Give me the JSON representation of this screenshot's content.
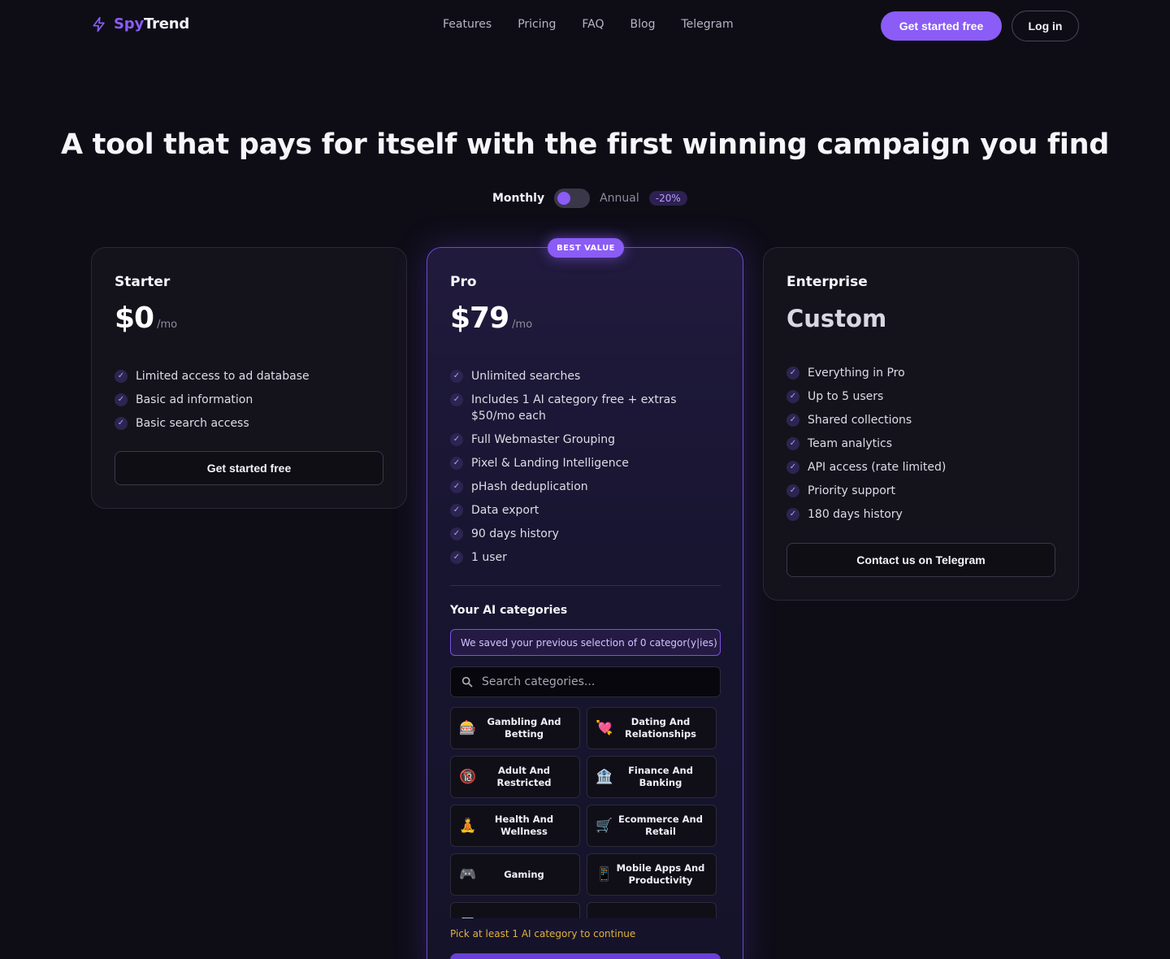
{
  "nav": {
    "logo_a": "Spy",
    "logo_b": "Trend",
    "links": [
      "Features",
      "Pricing",
      "FAQ",
      "Blog",
      "Telegram"
    ],
    "cta": "Get started free",
    "login": "Log in"
  },
  "hero": {
    "title": "A tool that pays for itself with the first winning campaign you find",
    "toggle_monthly": "Monthly",
    "toggle_annual": "Annual",
    "discount": "-20%"
  },
  "starter": {
    "name": "Starter",
    "price": "$0",
    "per": "/mo",
    "features": [
      "Limited access to ad database",
      "Basic ad information",
      "Basic search access"
    ],
    "button": "Get started free"
  },
  "pro": {
    "badge": "BEST VALUE",
    "name": "Pro",
    "price": "$79",
    "per": "/mo",
    "features": [
      "Unlimited searches",
      "Includes 1 AI category free + extras $50/mo each",
      "Full Webmaster Grouping",
      "Pixel & Landing Intelligence",
      "pHash deduplication",
      "Data export",
      "90 days history",
      "1 user"
    ],
    "ai_title": "Your AI categories",
    "saved_note": "We saved your previous selection of 0 categor(y|ies)",
    "search_placeholder": "Search categories...",
    "categories": [
      {
        "icon": "slot-machine-icon",
        "glyph": "🎰",
        "label": "Gambling And Betting"
      },
      {
        "icon": "heart-icon",
        "glyph": "💘",
        "label": "Dating And Relationships"
      },
      {
        "icon": "no-under-18-icon",
        "glyph": "🔞",
        "label": "Adult And Restricted"
      },
      {
        "icon": "bank-icon",
        "glyph": "🏦",
        "label": "Finance And Banking"
      },
      {
        "icon": "meditation-icon",
        "glyph": "🧘",
        "label": "Health And Wellness"
      },
      {
        "icon": "cart-icon",
        "glyph": "🛒",
        "label": "Ecommerce And Retail"
      },
      {
        "icon": "gamepad-icon",
        "glyph": "🎮",
        "label": "Gaming"
      },
      {
        "icon": "phone-icon",
        "glyph": "📱",
        "label": "Mobile Apps And Productivity"
      },
      {
        "icon": "laptop-icon",
        "glyph": "💻",
        "label": ""
      },
      {
        "icon": "category-icon",
        "glyph": "▪",
        "label": ""
      }
    ],
    "pick_msg": "Pick at least 1 AI category to continue"
  },
  "enterprise": {
    "name": "Enterprise",
    "price": "Custom",
    "features": [
      "Everything in Pro",
      "Up to 5 users",
      "Shared collections",
      "Team analytics",
      "API access (rate limited)",
      "Priority support",
      "180 days history"
    ],
    "button": "Contact us on Telegram"
  }
}
